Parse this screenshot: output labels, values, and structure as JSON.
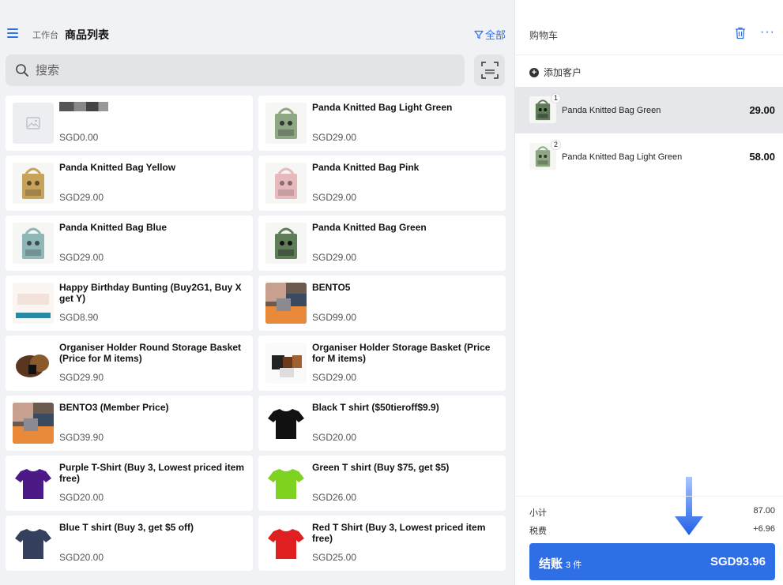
{
  "header": {
    "breadcrumb_home": "工作台",
    "title": "商品列表",
    "filter_label": "全部"
  },
  "search": {
    "placeholder": "搜索"
  },
  "products": [
    {
      "name": "",
      "price": "SGD0.00",
      "thumb": "placeholder-icon",
      "redacted": true
    },
    {
      "name": "Panda Knitted Bag Light Green",
      "price": "SGD29.00",
      "thumb": "lightgreen"
    },
    {
      "name": "Panda Knitted Bag Yellow",
      "price": "SGD29.00",
      "thumb": "yellow"
    },
    {
      "name": "Panda Knitted Bag Pink",
      "price": "SGD29.00",
      "thumb": "pink"
    },
    {
      "name": "Panda Knitted Bag Blue",
      "price": "SGD29.00",
      "thumb": "blue"
    },
    {
      "name": "Panda Knitted Bag Green",
      "price": "SGD29.00",
      "thumb": "green"
    },
    {
      "name": "Happy Birthday Bunting (Buy2G1, Buy X get Y)",
      "price": "SGD8.90",
      "thumb": "bunting"
    },
    {
      "name": "BENTO5",
      "price": "SGD99.00",
      "thumb": "bento"
    },
    {
      "name": "Organiser Holder Round Storage Basket (Price for M items)",
      "price": "SGD29.90",
      "thumb": "basket-round"
    },
    {
      "name": "Organiser Holder Storage Basket (Price for M items)",
      "price": "SGD29.00",
      "thumb": "basket"
    },
    {
      "name": "BENTO3 (Member Price)",
      "price": "SGD39.90",
      "thumb": "bento"
    },
    {
      "name": "Black T shirt ($50tieroff$9.9)",
      "price": "SGD20.00",
      "thumb": "tshirt",
      "color": "#111111"
    },
    {
      "name": "Purple T-Shirt (Buy 3, Lowest priced item free)",
      "price": "SGD20.00",
      "thumb": "tshirt",
      "color": "#4b1a86"
    },
    {
      "name": "Green T shirt (Buy $75, get $5)",
      "price": "SGD26.00",
      "thumb": "tshirt",
      "color": "#7ed321"
    },
    {
      "name": "Blue T shirt (Buy 3, get $5 off)",
      "price": "SGD20.00",
      "thumb": "tshirt",
      "color": "#34405e"
    },
    {
      "name": "Red T Shirt (Buy 3, Lowest priced item free)",
      "price": "SGD25.00",
      "thumb": "tshirt",
      "color": "#e02020"
    }
  ],
  "cart": {
    "title": "购物车",
    "add_customer": "添加客户",
    "items": [
      {
        "qty": "1",
        "name": "Panda Knitted Bag Green",
        "total": "29.00",
        "selected": true
      },
      {
        "qty": "2",
        "name": "Panda Knitted Bag Light Green",
        "total": "58.00",
        "selected": false
      }
    ],
    "subtotal_label": "小计",
    "subtotal": "87.00",
    "tax_label": "税费",
    "tax": "+6.96",
    "checkout_label": "结账",
    "checkout_count": "3 件",
    "checkout_total": "SGD93.96"
  },
  "colors": {
    "accent": "#2e6fe6"
  }
}
